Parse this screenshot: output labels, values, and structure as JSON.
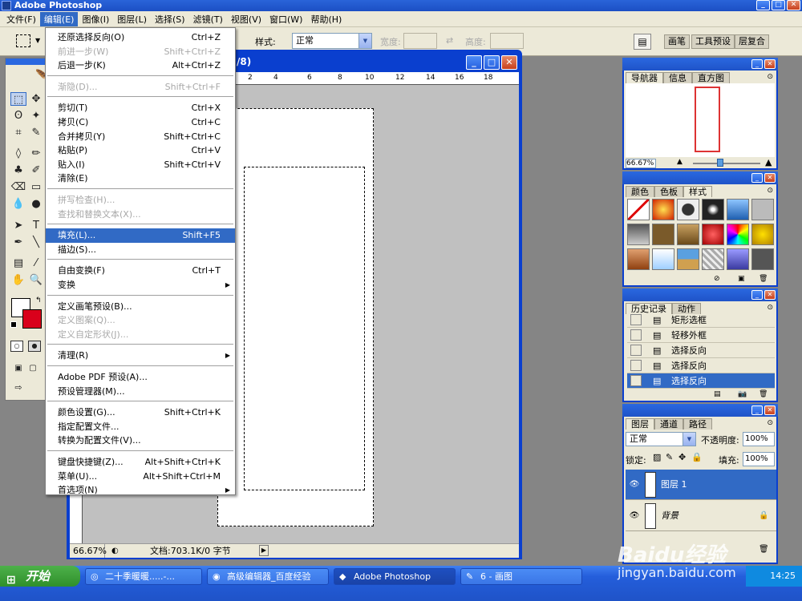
{
  "app": {
    "title": "Adobe Photoshop"
  },
  "menubar": [
    "文件(F)",
    "编辑(E)",
    "图像(I)",
    "图层(L)",
    "选择(S)",
    "滤镜(T)",
    "视图(V)",
    "窗口(W)",
    "帮助(H)"
  ],
  "options": {
    "style_label": "样式:",
    "style_value": "正常",
    "width_label": "宽度:",
    "height_label": "高度:",
    "panel_chips": [
      "画笔",
      "工具预设",
      "层复合"
    ]
  },
  "document": {
    "title_suffix": "/8)",
    "zoom": "66.67%",
    "status": "文档:703.1K/0 字节",
    "ruler_ticks": [
      "2",
      "4",
      "6",
      "8",
      "10",
      "12",
      "14",
      "16",
      "18"
    ]
  },
  "edit_menu": [
    {
      "label": "还原选择反向(O)",
      "shortcut": "Ctrl+Z",
      "state": "normal"
    },
    {
      "label": "前进一步(W)",
      "shortcut": "Shift+Ctrl+Z",
      "state": "disabled"
    },
    {
      "label": "后退一步(K)",
      "shortcut": "Alt+Ctrl+Z",
      "state": "normal"
    },
    {
      "label": "渐隐(D)...",
      "shortcut": "Shift+Ctrl+F",
      "state": "disabled"
    },
    {
      "label": "剪切(T)",
      "shortcut": "Ctrl+X",
      "state": "normal"
    },
    {
      "label": "拷贝(C)",
      "shortcut": "Ctrl+C",
      "state": "normal"
    },
    {
      "label": "合并拷贝(Y)",
      "shortcut": "Shift+Ctrl+C",
      "state": "normal"
    },
    {
      "label": "粘贴(P)",
      "shortcut": "Ctrl+V",
      "state": "normal"
    },
    {
      "label": "贴入(I)",
      "shortcut": "Shift+Ctrl+V",
      "state": "normal"
    },
    {
      "label": "清除(E)",
      "shortcut": "",
      "state": "normal"
    },
    {
      "label": "拼写检查(H)...",
      "shortcut": "",
      "state": "disabled"
    },
    {
      "label": "查找和替换文本(X)...",
      "shortcut": "",
      "state": "disabled"
    },
    {
      "label": "填充(L)...",
      "shortcut": "Shift+F5",
      "state": "highlighted"
    },
    {
      "label": "描边(S)...",
      "shortcut": "",
      "state": "normal"
    },
    {
      "label": "自由变换(F)",
      "shortcut": "Ctrl+T",
      "state": "normal"
    },
    {
      "label": "变换",
      "shortcut": "",
      "state": "submenu"
    },
    {
      "label": "定义画笔预设(B)...",
      "shortcut": "",
      "state": "normal"
    },
    {
      "label": "定义图案(Q)...",
      "shortcut": "",
      "state": "disabled"
    },
    {
      "label": "定义自定形状(J)...",
      "shortcut": "",
      "state": "disabled"
    },
    {
      "label": "清理(R)",
      "shortcut": "",
      "state": "submenu"
    },
    {
      "label": "Adobe PDF 预设(A)...",
      "shortcut": "",
      "state": "normal"
    },
    {
      "label": "预设管理器(M)...",
      "shortcut": "",
      "state": "normal"
    },
    {
      "label": "颜色设置(G)...",
      "shortcut": "Shift+Ctrl+K",
      "state": "normal"
    },
    {
      "label": "指定配置文件...",
      "shortcut": "",
      "state": "normal"
    },
    {
      "label": "转换为配置文件(V)...",
      "shortcut": "",
      "state": "normal"
    },
    {
      "label": "键盘快捷键(Z)...",
      "shortcut": "Alt+Shift+Ctrl+K",
      "state": "normal"
    },
    {
      "label": "菜单(U)...",
      "shortcut": "Alt+Shift+Ctrl+M",
      "state": "normal"
    },
    {
      "label": "首选项(N)",
      "shortcut": "",
      "state": "submenu"
    }
  ],
  "navigator": {
    "tabs": [
      "导航器",
      "信息",
      "直方图"
    ],
    "zoom": "66.67%"
  },
  "styles_panel": {
    "tabs": [
      "颜色",
      "色板",
      "样式"
    ]
  },
  "history": {
    "tabs": [
      "历史记录",
      "动作"
    ],
    "items": [
      "矩形选框",
      "轻移外框",
      "选择反向",
      "选择反向",
      "选择反向"
    ]
  },
  "layers": {
    "tabs": [
      "图层",
      "通道",
      "路径"
    ],
    "blend_mode": "正常",
    "opacity_label": "不透明度:",
    "opacity": "100%",
    "lock_label": "锁定:",
    "fill_label": "填充:",
    "fill": "100%",
    "items": [
      {
        "name": "图层 1",
        "selected": true
      },
      {
        "name": "背景",
        "selected": false
      }
    ]
  },
  "taskbar": {
    "start": "开始",
    "items": [
      "二十季暖暖.....-...",
      "高级编辑器_百度经验",
      "Adobe Photoshop",
      "6 - 画图"
    ],
    "clock": "14:25"
  },
  "watermark": {
    "brand": "Baidu经验",
    "url": "jingyan.baidu.com"
  }
}
